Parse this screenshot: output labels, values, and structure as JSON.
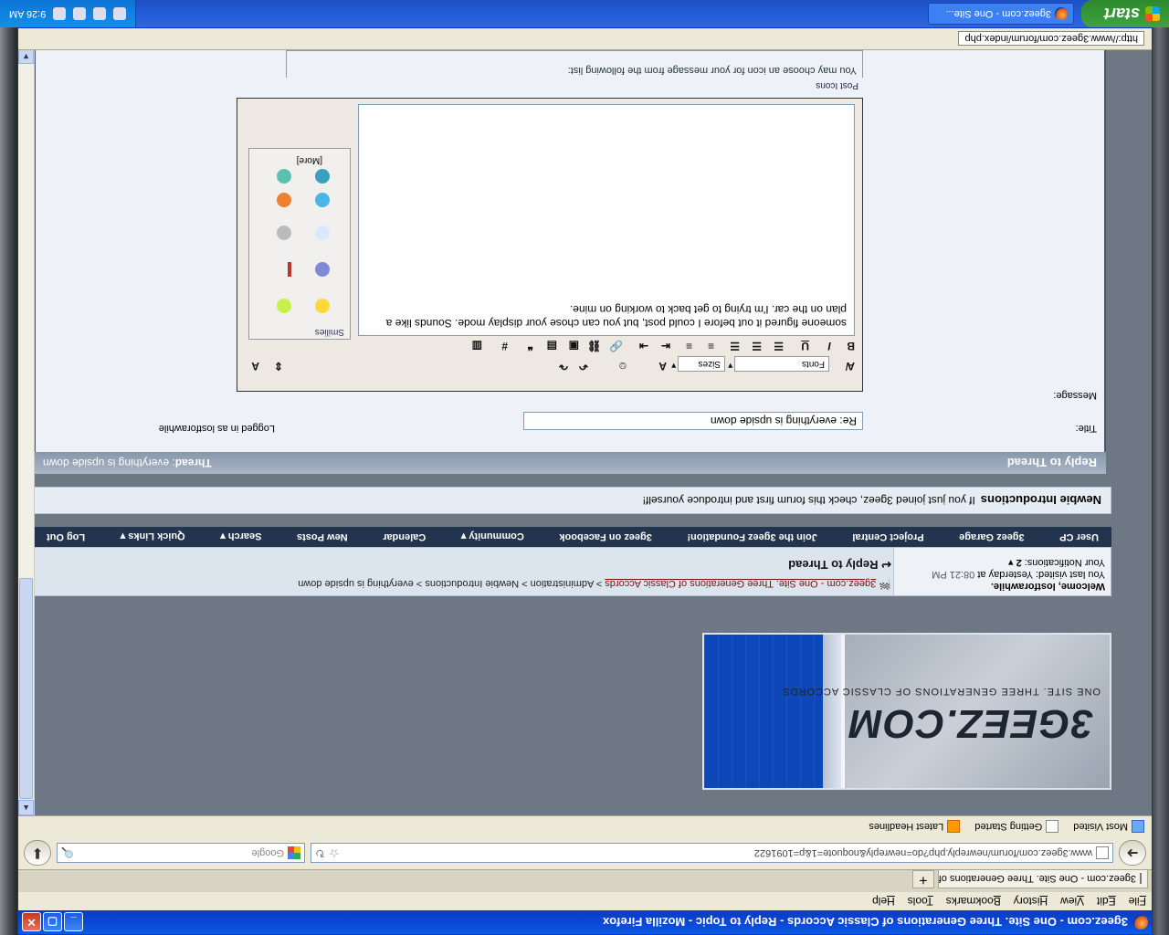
{
  "window": {
    "title": "3geez.com - One Site. Three Generations of Classic Accords - Reply to Topic - Mozilla Firefox"
  },
  "menu": [
    "File",
    "Edit",
    "View",
    "History",
    "Bookmarks",
    "Tools",
    "Help"
  ],
  "tab": {
    "label": "3geez.com - One Site. Three Generations of..."
  },
  "navbar": {
    "url": "www.3geez.com/forum/newreply.php?do=newreply&noquote=1&p=1091622",
    "search_placeholder": "Google"
  },
  "bookmarks": [
    "Most Visited",
    "Getting Started",
    "Latest Headlines"
  ],
  "logo": {
    "wordmark": "3GEEZ.COM",
    "tagline": "ONE SITE. THREE GENERATIONS OF CLASSIC ACCORDS"
  },
  "breadcrumb": {
    "home": "3geez.com - One Site. Three Generations of Classic Accords",
    "sep": ">",
    "items": [
      "Administration",
      "Newbie Introductions",
      "everything is upside down"
    ]
  },
  "page_title": "Reply to Thread",
  "user": {
    "welcome_prefix": "Welcome, ",
    "username": "lostforawhile.",
    "last_visited_label": "You last visited: Yesterday at ",
    "last_visited_time": "08:21 PM",
    "notifications_label": "Your Notifications: ",
    "notifications_count": "2"
  },
  "nav_items": [
    "User CP",
    "3geez Garage",
    "Project Central",
    "Join the 3geez Foundation!",
    "3geez on Facebook",
    "Community",
    "Calendar",
    "New Posts",
    "Search",
    "Quick Links",
    "Log Out"
  ],
  "notice": {
    "title": "Newbie Introductions",
    "text": "If you just joined 3geez, check this forum first and introduce yourself!"
  },
  "reply": {
    "header": "Reply to Thread",
    "thread_label": "Thread",
    "thread_name": ": everything is upside down",
    "logged_in": "Logged in as lostforawhile",
    "title_label": "Title:",
    "title_value": "Re: everything is upside down",
    "message_label": "Message:",
    "fonts_label": "Fonts",
    "sizes_label": "Sizes",
    "message_text": "someone figured it out before I could post, but you can chose your display mode. Sounds like a plan on the car. I'm trying to get back to working on mine.",
    "smilies_title": "Smilies",
    "smilies_more": "[More]",
    "post_icons_title": "Post Icons",
    "post_icons_text": "You may choose an icon for your message from the following list:"
  },
  "statusbar": {
    "url": "http://www.3geez.com/forum/index.php"
  },
  "taskbar": {
    "start": "start",
    "item": "3geez.com - One Site...",
    "clock": "9:26 AM"
  }
}
